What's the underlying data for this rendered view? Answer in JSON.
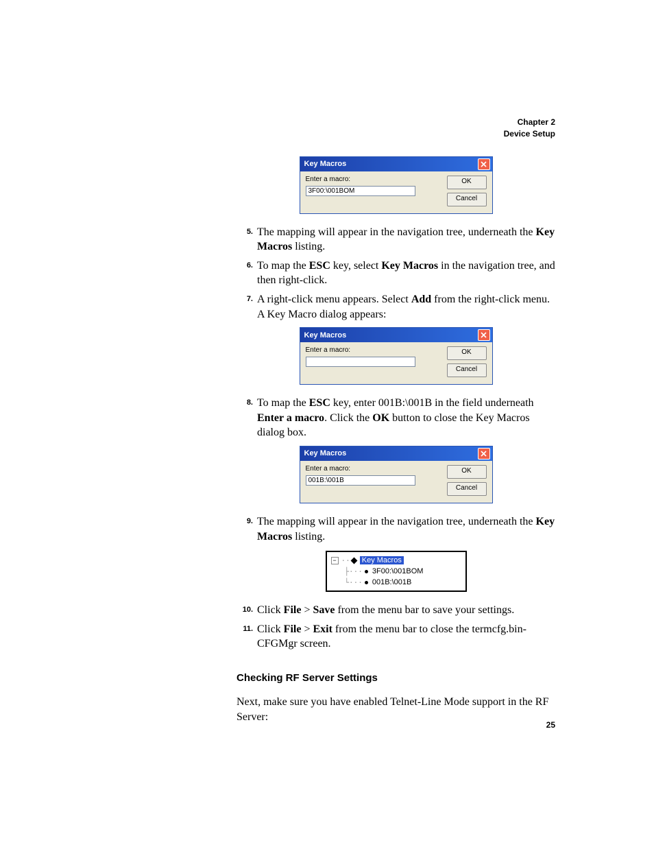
{
  "header": {
    "line1": "Chapter 2",
    "line2": "Device Setup"
  },
  "dialog1": {
    "title": "Key Macros",
    "label": "Enter a macro:",
    "value": "3F00:\\001BOM",
    "ok": "OK",
    "cancel": "Cancel"
  },
  "step5": {
    "num": "5.",
    "text_a": "The mapping will appear in the navigation tree, underneath the ",
    "bold_a": "Key Macros",
    "text_b": " listing."
  },
  "step6": {
    "num": "6.",
    "text_a": "To map the ",
    "bold_a": "ESC",
    "text_b": " key, select ",
    "bold_b": "Key Macros",
    "text_c": " in the navigation tree, and then right-click."
  },
  "step7": {
    "num": "7.",
    "text_a": "A right-click menu appears. Select ",
    "bold_a": "Add",
    "text_b": " from the right-click menu. A Key Macro dialog appears:"
  },
  "dialog2": {
    "title": "Key Macros",
    "label": "Enter a macro:",
    "value": "",
    "ok": "OK",
    "cancel": "Cancel"
  },
  "step8": {
    "num": "8.",
    "text_a": "To map the ",
    "bold_a": "ESC",
    "text_b": " key, enter 001B:\\001B in the field underneath ",
    "bold_b": "Enter a macro",
    "text_c": ". Click the ",
    "bold_c": "OK",
    "text_d": " button to close the Key Macros dialog box."
  },
  "dialog3": {
    "title": "Key Macros",
    "label": "Enter a macro:",
    "value": "001B:\\001B",
    "ok": "OK",
    "cancel": "Cancel"
  },
  "step9": {
    "num": "9.",
    "text_a": "The mapping will appear in the navigation tree, underneath the ",
    "bold_a": "Key Macros",
    "text_b": " listing."
  },
  "tree": {
    "node_selected": "Key Macros",
    "item1": "3F00:\\001BOM",
    "item2": "001B:\\001B"
  },
  "step10": {
    "num": "10.",
    "text_a": "Click ",
    "bold_a": "File",
    "text_b": " > ",
    "bold_b": "Save",
    "text_c": " from the menu bar to save your settings."
  },
  "step11": {
    "num": "11.",
    "text_a": "Click ",
    "bold_a": "File",
    "text_b": " > ",
    "bold_b": "Exit",
    "text_c": " from the menu bar to close the termcfg.bin-CFGMgr screen."
  },
  "section_heading": "Checking RF Server Settings",
  "body_para": "Next, make sure you have enabled Telnet-Line Mode support in the RF Server:",
  "page_number": "25"
}
